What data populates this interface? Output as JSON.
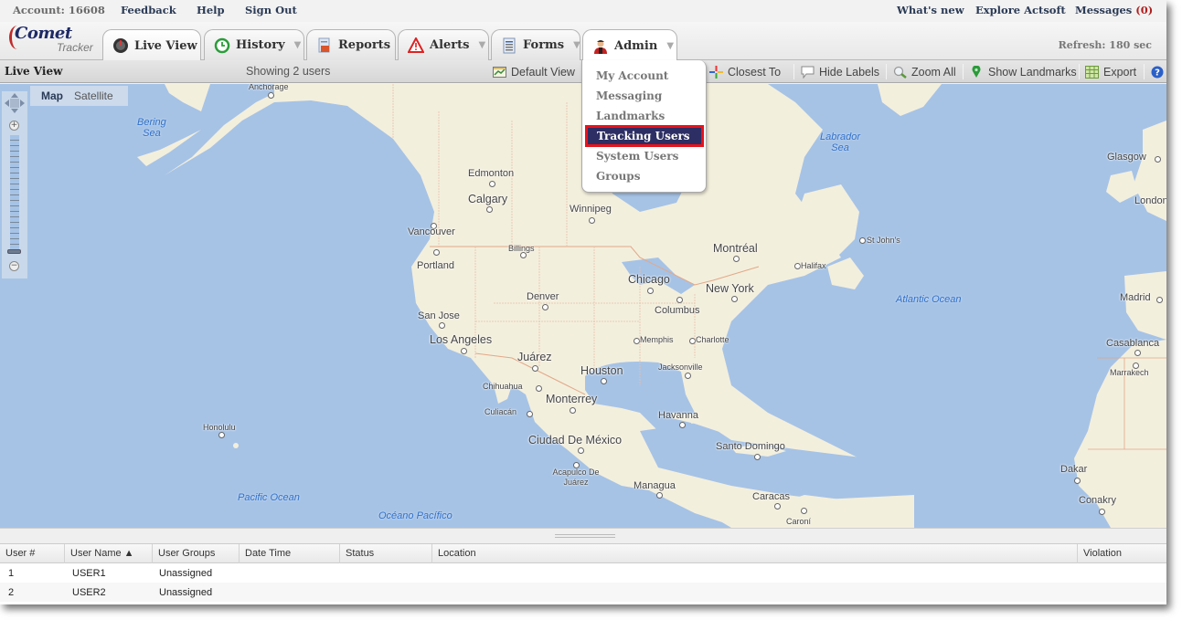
{
  "top_links": {
    "account": "Account: 16608",
    "feedback": "Feedback",
    "help": "Help",
    "sign_out": "Sign Out",
    "whats_new": "What's new",
    "explore": "Explore Actsoft",
    "messages_label": "Messages",
    "messages_count": "(0)"
  },
  "logo": {
    "brand": "Comet",
    "product": "Tracker"
  },
  "tabs": [
    {
      "label": "Live View",
      "icon": "gauge-icon",
      "active": true
    },
    {
      "label": "History",
      "icon": "clock-icon",
      "dropdown": true
    },
    {
      "label": "Reports",
      "icon": "report-icon"
    },
    {
      "label": "Alerts",
      "icon": "warning-icon",
      "dropdown": true
    },
    {
      "label": "Forms",
      "icon": "form-icon",
      "dropdown": true
    },
    {
      "label": "Admin",
      "icon": "user-icon",
      "dropdown": true,
      "open": true
    }
  ],
  "caret": "▼",
  "refresh": "Refresh: 180 sec",
  "toolbar": {
    "title": "Live View",
    "showing": "Showing 2 users",
    "buttons": [
      {
        "label": "Default View",
        "icon": "map-view-icon"
      },
      {
        "label": "Closest To",
        "icon": "crosshair-icon"
      },
      {
        "label": "Hide Labels",
        "icon": "speech-bubble-icon"
      },
      {
        "label": "Zoom All",
        "icon": "magnifier-icon"
      },
      {
        "label": "Show Landmarks",
        "icon": "map-pin-icon"
      },
      {
        "label": "Export",
        "icon": "spreadsheet-icon"
      }
    ]
  },
  "admin_menu": {
    "items": [
      "My Account",
      "Messaging",
      "Landmarks",
      "Tracking Users",
      "System Users",
      "Groups"
    ],
    "selected": "Tracking Users"
  },
  "map": {
    "type_buttons": {
      "map": "Map",
      "satellite": "Satellite"
    },
    "water_labels": [
      "Bering Sea",
      "Labrador Sea",
      "Atlantic Ocean",
      "Pacific Ocean",
      "Océano Pacífico"
    ],
    "cities": [
      "Anchorage",
      "Edmonton",
      "Calgary",
      "Winnipeg",
      "Vancouver",
      "Billings",
      "Portland",
      "Montréal",
      "Halifax",
      "St John's",
      "Chicago",
      "New York",
      "Denver",
      "Columbus",
      "San Jose",
      "Los Angeles",
      "Memphis",
      "Charlotte",
      "Juárez",
      "Houston",
      "Jacksonville",
      "Chihuahua",
      "Monterrey",
      "Culiacán",
      "Havanna",
      "Ciudad De México",
      "Santo Domingo",
      "Acapulco De Juárez",
      "Managua",
      "Caracas",
      "Caroní",
      "Honolulu",
      "Glasgow",
      "London",
      "Madrid",
      "Casablanca",
      "Marrakech",
      "Dakar",
      "Conakry"
    ]
  },
  "grid": {
    "columns": [
      "User #",
      "User Name ▲",
      "User Groups",
      "Date Time",
      "Status",
      "Location",
      "Violation"
    ],
    "rows": [
      {
        "num": "1",
        "name": "USER1",
        "group": "Unassigned",
        "datetime": "",
        "status": "",
        "location": "",
        "violation": ""
      },
      {
        "num": "2",
        "name": "USER2",
        "group": "Unassigned",
        "datetime": "",
        "status": "",
        "location": "",
        "violation": ""
      }
    ]
  },
  "colors": {
    "menu_selected_bg": "#2d2e63",
    "highlight_border": "#e8121a",
    "water": "#a6c3e6",
    "land": "#f3efdd"
  }
}
